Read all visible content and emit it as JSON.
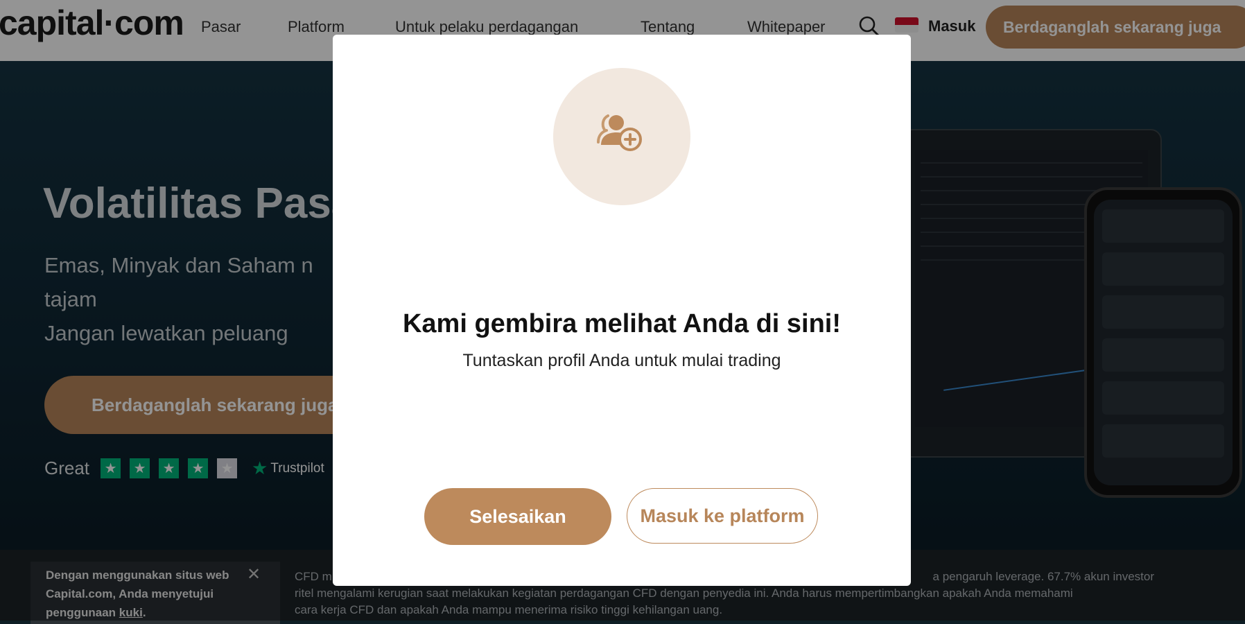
{
  "header": {
    "logo_text": "capital·com",
    "nav": [
      {
        "label": "Pasar"
      },
      {
        "label": "Platform"
      },
      {
        "label": "Untuk pelaku perdagangan"
      },
      {
        "label": "Tentang"
      },
      {
        "label": "Whitepaper"
      }
    ],
    "login_label": "Masuk",
    "cta_label": "Berdaganglah sekarang juga"
  },
  "hero": {
    "title": "Volatilitas Pasar",
    "subtitle_lines": [
      "Emas, Minyak dan Saham n",
      "tajam",
      "Jangan lewatkan peluang"
    ],
    "cta_label": "Berdaganglah sekarang juga",
    "rating_label": "Great",
    "rating_stars": 4,
    "rating_max": 5,
    "trustpilot_label": "Trustpilot"
  },
  "footer": {
    "cookie_text_part1": "Dengan menggunakan situs web Capital.com, Anda menyetujui penggunaan ",
    "cookie_link": "kuki",
    "cookie_text_end": ".",
    "risk_line1_start": "CFD m",
    "risk_line1_end": "a pengaruh leverage. 67.7% akun investor",
    "risk_line2": "ritel mengalami kerugian saat melakukan kegiatan perdagangan CFD dengan penyedia ini. Anda harus mempertimbangkan apakah Anda memahami",
    "risk_line3": "cara kerja CFD dan apakah Anda mampu menerima risiko tinggi kehilangan uang."
  },
  "modal": {
    "icon": "user-add-icon",
    "title": "Kami gembira melihat Anda di sini!",
    "subtitle": "Tuntaskan profil Anda untuk mulai trading",
    "primary_button": "Selesaikan",
    "secondary_button": "Masuk ke platform"
  },
  "colors": {
    "accent": "#bd8a5c",
    "icon_bg": "#f2e8df",
    "overlay": "rgba(0,0,0,0.42)",
    "trustpilot_green": "#00b67a"
  }
}
